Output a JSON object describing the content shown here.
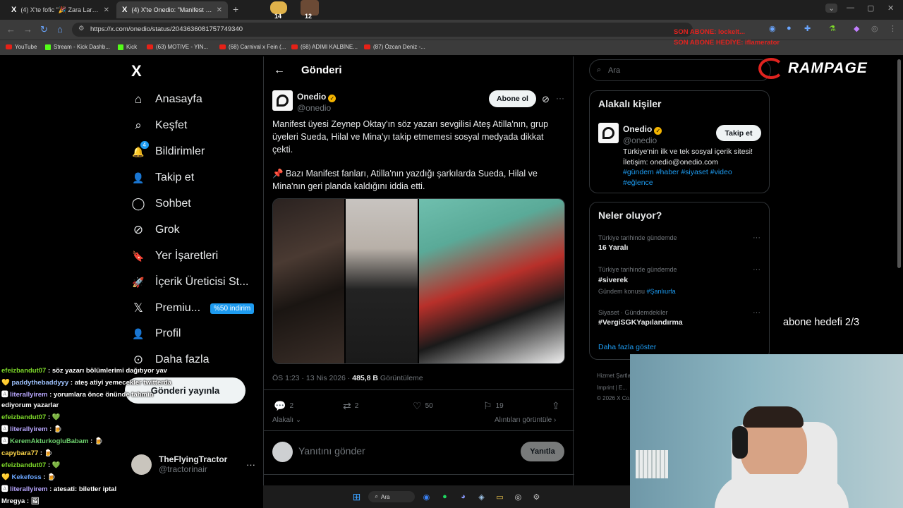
{
  "browser": {
    "tabs": [
      {
        "label": "(4) X'te fofic \"🎉 Zara Larsson",
        "active": false
      },
      {
        "label": "(4) X'te Onedio: \"Manifest üyes",
        "active": true
      }
    ],
    "new_tab": "+",
    "url": "https://x.com/onedio/status/2043636081757749340",
    "stickers": [
      "14",
      "12"
    ],
    "bookmarks": [
      "YouTube",
      "Stream - Kick Dashb...",
      "Kick",
      "(63) MOTIVE - YIN...",
      "(68) Carnival x Fein (...",
      "(68) ADIMI KALBİNE...",
      "(87) Özcan Deniz -..."
    ]
  },
  "overlays": {
    "red_line_1": "SON ABONE: lockelt...",
    "red_line_2": "SON ABONE HEDİYE: iflamerator",
    "brand": "RAMPAGE",
    "sub_goal": "abone hedefi 2/3"
  },
  "sidebar": {
    "logo": "X",
    "items": [
      {
        "label": "Anasayfa",
        "icon": "home-icon",
        "glyph": "⌂"
      },
      {
        "label": "Keşfet",
        "icon": "search-icon",
        "glyph": "⌕"
      },
      {
        "label": "Bildirimler",
        "icon": "bell-icon",
        "glyph": "🔔",
        "badge": "4"
      },
      {
        "label": "Takip et",
        "icon": "follow-icon",
        "glyph": "👤"
      },
      {
        "label": "Sohbet",
        "icon": "chat-icon",
        "glyph": "◯"
      },
      {
        "label": "Grok",
        "icon": "grok-icon",
        "glyph": "⊘"
      },
      {
        "label": "Yer İşaretleri",
        "icon": "bookmark-icon",
        "glyph": "🔖"
      },
      {
        "label": "İçerik Üreticisi St...",
        "icon": "rocket-icon",
        "glyph": "🚀"
      },
      {
        "label": "Premiu...",
        "icon": "x-premium-icon",
        "glyph": "𝕏",
        "promo": "%50 indirim"
      },
      {
        "label": "Profil",
        "icon": "profile-icon",
        "glyph": "👤"
      },
      {
        "label": "Daha fazla",
        "icon": "more-circle-icon",
        "glyph": "⊙"
      }
    ],
    "post_button": "Gönderi yayınla",
    "account": {
      "name": "TheFlyingTractor",
      "handle": "@tractorinair",
      "more": "···"
    }
  },
  "chat": [
    {
      "user": "efeizbandut07",
      "msg": "söz yazarı bölümlerimi dağıtıyor yav",
      "color": "#7fdc2a"
    },
    {
      "user": "paddythebaddyyy",
      "msg": "ateş atiyi yemecekler twitterda",
      "color": "#9fc3ff"
    },
    {
      "user": "literallyirem",
      "msg": "yorumlara önce önünde tahmin ediyorum yazarlar",
      "color": "#b9a7ff"
    },
    {
      "user": "efeizbandut07",
      "msg": "💚",
      "color": "#7fdc2a"
    },
    {
      "user": "literallyirem",
      "msg": "🍺",
      "color": "#b9a7ff"
    },
    {
      "user": "KeremAkturkogluBabam",
      "msg": "🍺",
      "color": "#6fd46f"
    },
    {
      "user": "capybara77",
      "msg": "🍺",
      "color": "#ffd84a"
    },
    {
      "user": "efeizbandut07",
      "msg": "💚",
      "color": "#7fdc2a"
    },
    {
      "user": "Kekefoss",
      "msg": "🍺",
      "color": "#6aa6ff"
    },
    {
      "user": "literallyirem",
      "msg": "atesati: biletler iptal",
      "color": "#b9a7ff"
    },
    {
      "user": "Mregya",
      "msg": "🖼",
      "color": "#ffffff"
    }
  ],
  "post": {
    "header": "Gönderi",
    "author": {
      "name": "Onedio",
      "handle": "@onedio"
    },
    "subscribe": "Abone ol",
    "more": "···",
    "text_1": "Manifest üyesi Zeynep Oktay'ın söz yazarı sevgilisi Ateş Atilla'nın, grup üyeleri Sueda, Hilal ve Mina'yı takip etmemesi sosyal medyada dikkat çekti.",
    "text_2": "📌 Bazı Manifest fanları, Atilla'nın yazdığı şarkılarda Sueda, Hilal ve Mina'nın geri planda kaldığını iddia etti.",
    "time": "ÖS 1:23 · 13 Nis 2026 · ",
    "views": "485,8 B",
    "views_label": " Görüntüleme",
    "stats": {
      "replies": "2",
      "reposts": "2",
      "likes": "50",
      "bookmarks": "19"
    },
    "relevant": "Alakalı",
    "quotes": "Alıntıları görüntüle",
    "reply_placeholder": "Yanıtını gönder",
    "reply_button": "Yanıtla"
  },
  "right": {
    "search_placeholder": "Ara",
    "related_title": "Alakalı kişiler",
    "related": {
      "name": "Onedio",
      "handle": "@onedio",
      "follow": "Takip et",
      "bio": "Türkiye'nin ilk ve tek sosyal içerik sitesi! İletişim: onedio@onedio.com",
      "tags": "#gündem #haber #siyaset #video #eğlence"
    },
    "trends_title": "Neler oluyor?",
    "trends": [
      {
        "category": "Türkiye tarihinde gündemde",
        "name": "16 Yaralı",
        "extra": ""
      },
      {
        "category": "Türkiye tarihinde gündemde",
        "name": "#siverek",
        "extra_label": "Gündem konusu ",
        "extra_link": "#Şanlıurfa"
      },
      {
        "category": "Siyaset · Gündemdekiler",
        "name": "#VergiSGKYapılandırma",
        "extra": ""
      }
    ],
    "show_more": "Daha fazla göster",
    "footer_1": "Hizmet Şartla...",
    "footer_2": "Imprint  |  E...",
    "footer_3": "© 2026 X Co..."
  },
  "taskbar": {
    "search": "Ara"
  }
}
